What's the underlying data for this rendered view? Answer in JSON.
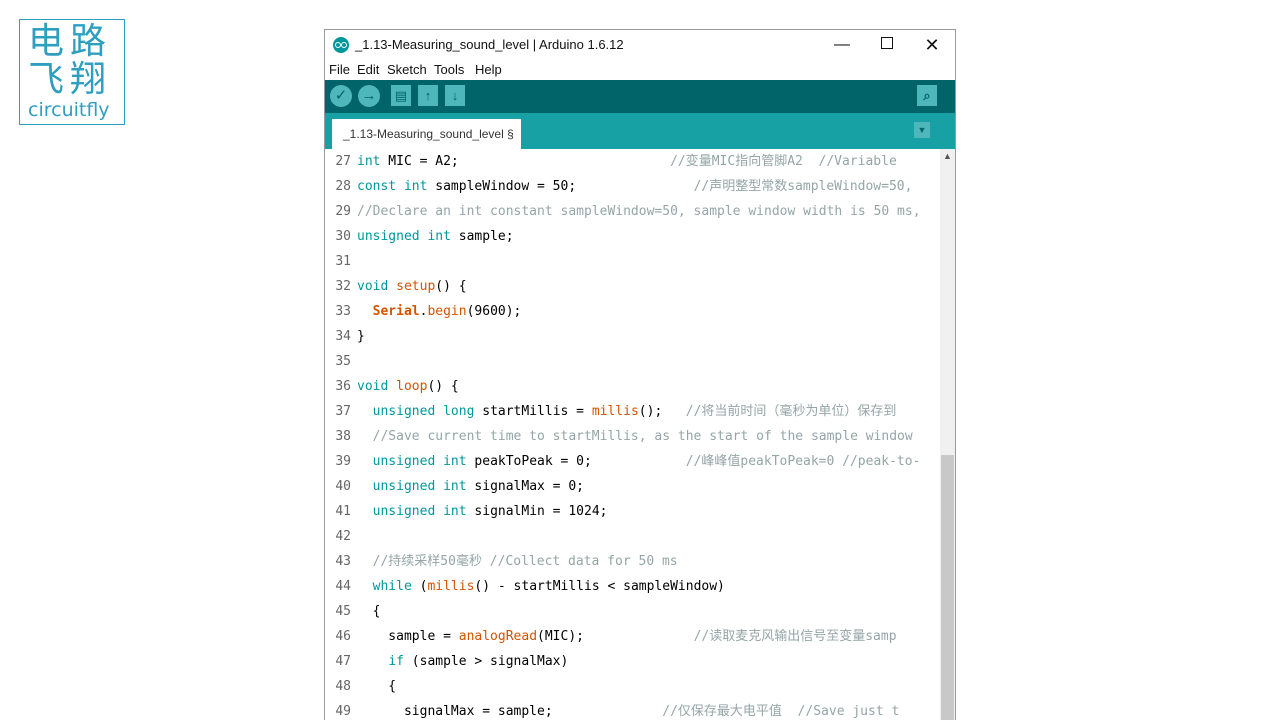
{
  "logo": {
    "cn_line1": "电路",
    "cn_line2": "飞翔",
    "en": "circuitfly"
  },
  "window": {
    "title": "_1.13-Measuring_sound_level | Arduino 1.6.12",
    "controls": {
      "minimize": "—",
      "maximize": "",
      "close": "✕"
    }
  },
  "menu": {
    "file": "File",
    "edit": "Edit",
    "sketch": "Sketch",
    "tools": "Tools",
    "help": "Help"
  },
  "toolbar": {
    "verify": "✓",
    "upload": "→",
    "new": "▤",
    "open": "↑",
    "save": "↓",
    "serial_monitor": "⌕"
  },
  "tab": {
    "label": "_1.13-Measuring_sound_level §",
    "menu_arrow": "▼"
  },
  "colors": {
    "toolbar": "#006468",
    "tabbar": "#17a1a5",
    "button": "#4db7bb",
    "keyword": "#00979c",
    "function": "#d35400",
    "comment": "#95a5a6"
  },
  "code_lines": [
    {
      "num": "27",
      "tokens": [
        {
          "t": "int",
          "c": "kw"
        },
        {
          "t": " MIC = A2;                           ",
          "c": ""
        },
        {
          "t": "//变量MIC指向管脚A2  //Variable",
          "c": "cm"
        }
      ]
    },
    {
      "num": "28",
      "tokens": [
        {
          "t": "const",
          "c": "kw"
        },
        {
          "t": " ",
          "c": ""
        },
        {
          "t": "int",
          "c": "kw"
        },
        {
          "t": " sampleWindow = 50;               ",
          "c": ""
        },
        {
          "t": "//声明整型常数sampleWindow=50,",
          "c": "cm"
        }
      ]
    },
    {
      "num": "29",
      "tokens": [
        {
          "t": "//Declare an int constant sampleWindow=50, sample window width is 50 ms,",
          "c": "cm"
        }
      ]
    },
    {
      "num": "30",
      "tokens": [
        {
          "t": "unsigned",
          "c": "kw"
        },
        {
          "t": " ",
          "c": ""
        },
        {
          "t": "int",
          "c": "kw"
        },
        {
          "t": " sample;",
          "c": ""
        }
      ]
    },
    {
      "num": "31",
      "tokens": []
    },
    {
      "num": "32",
      "tokens": [
        {
          "t": "void",
          "c": "kw"
        },
        {
          "t": " ",
          "c": ""
        },
        {
          "t": "setup",
          "c": "fn"
        },
        {
          "t": "() {",
          "c": ""
        }
      ]
    },
    {
      "num": "33",
      "tokens": [
        {
          "t": "  ",
          "c": ""
        },
        {
          "t": "Serial",
          "c": "obj"
        },
        {
          "t": ".",
          "c": ""
        },
        {
          "t": "begin",
          "c": "fn"
        },
        {
          "t": "(9600);",
          "c": ""
        }
      ]
    },
    {
      "num": "34",
      "tokens": [
        {
          "t": "}",
          "c": ""
        }
      ]
    },
    {
      "num": "35",
      "tokens": []
    },
    {
      "num": "36",
      "tokens": [
        {
          "t": "void",
          "c": "kw"
        },
        {
          "t": " ",
          "c": ""
        },
        {
          "t": "loop",
          "c": "fn"
        },
        {
          "t": "() {",
          "c": ""
        }
      ]
    },
    {
      "num": "37",
      "tokens": [
        {
          "t": "  ",
          "c": ""
        },
        {
          "t": "unsigned",
          "c": "kw"
        },
        {
          "t": " ",
          "c": ""
        },
        {
          "t": "long",
          "c": "kw"
        },
        {
          "t": " startMillis = ",
          "c": ""
        },
        {
          "t": "millis",
          "c": "fn"
        },
        {
          "t": "();   ",
          "c": ""
        },
        {
          "t": "//将当前时间（毫秒为单位）保存到",
          "c": "cm"
        }
      ]
    },
    {
      "num": "38",
      "tokens": [
        {
          "t": "  //Save current time to startMillis, as the start of the sample window",
          "c": "cm"
        }
      ]
    },
    {
      "num": "39",
      "tokens": [
        {
          "t": "  ",
          "c": ""
        },
        {
          "t": "unsigned",
          "c": "kw"
        },
        {
          "t": " ",
          "c": ""
        },
        {
          "t": "int",
          "c": "kw"
        },
        {
          "t": " peakToPeak = 0;            ",
          "c": ""
        },
        {
          "t": "//峰峰值peakToPeak=0 //peak-to-",
          "c": "cm"
        }
      ]
    },
    {
      "num": "40",
      "tokens": [
        {
          "t": "  ",
          "c": ""
        },
        {
          "t": "unsigned",
          "c": "kw"
        },
        {
          "t": " ",
          "c": ""
        },
        {
          "t": "int",
          "c": "kw"
        },
        {
          "t": " signalMax = 0;",
          "c": ""
        }
      ]
    },
    {
      "num": "41",
      "tokens": [
        {
          "t": "  ",
          "c": ""
        },
        {
          "t": "unsigned",
          "c": "kw"
        },
        {
          "t": " ",
          "c": ""
        },
        {
          "t": "int",
          "c": "kw"
        },
        {
          "t": " signalMin = 1024;",
          "c": ""
        }
      ]
    },
    {
      "num": "42",
      "tokens": []
    },
    {
      "num": "43",
      "tokens": [
        {
          "t": "  //持续采样50毫秒 //Collect data for 50 ms",
          "c": "cm"
        }
      ]
    },
    {
      "num": "44",
      "tokens": [
        {
          "t": "  ",
          "c": ""
        },
        {
          "t": "while",
          "c": "kw"
        },
        {
          "t": " (",
          "c": ""
        },
        {
          "t": "millis",
          "c": "fn"
        },
        {
          "t": "() - startMillis < sampleWindow)",
          "c": ""
        }
      ]
    },
    {
      "num": "45",
      "tokens": [
        {
          "t": "  {",
          "c": ""
        }
      ]
    },
    {
      "num": "46",
      "tokens": [
        {
          "t": "    sample = ",
          "c": ""
        },
        {
          "t": "analogRead",
          "c": "fn"
        },
        {
          "t": "(MIC);              ",
          "c": ""
        },
        {
          "t": "//读取麦克风输出信号至变量samp",
          "c": "cm"
        }
      ]
    },
    {
      "num": "47",
      "tokens": [
        {
          "t": "    ",
          "c": ""
        },
        {
          "t": "if",
          "c": "kw"
        },
        {
          "t": " (sample > signalMax)",
          "c": ""
        }
      ]
    },
    {
      "num": "48",
      "tokens": [
        {
          "t": "    {",
          "c": ""
        }
      ]
    },
    {
      "num": "49",
      "tokens": [
        {
          "t": "      signalMax = sample;              ",
          "c": ""
        },
        {
          "t": "//仅保存最大电平值  //Save just t",
          "c": "cm"
        }
      ]
    }
  ]
}
